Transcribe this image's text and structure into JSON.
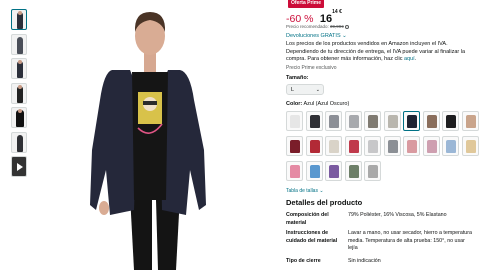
{
  "badge": "Oferta Prime",
  "price": {
    "discount": "-60 %",
    "whole": "16",
    "fraction": "14 €"
  },
  "reference": {
    "label": "Precio recomendado:",
    "value": "39,99€"
  },
  "returns_link": "Devoluciones GRATIS",
  "vat": {
    "text": "Los precios de los productos vendidos en Amazon incluyen el IVA. Dependiendo de tu dirección de entrega, el IVA puede variar al finalizar la compra. Para obtener más información, haz clic",
    "link": "aquí"
  },
  "prime_note": "Precio Prime exclusivo",
  "size": {
    "label": "Tamaño:",
    "value": "L"
  },
  "color": {
    "label": "Color:",
    "value": "Azul (Azul Oscuro)"
  },
  "swatch_colors": [
    [
      "#e6e6e6",
      "#2f3035",
      "#8c8f96",
      "#a7a9ad",
      "#7f7a71",
      "#b9b6ae",
      "#1f2433",
      "#8a6e5c",
      "#1d1d1f",
      "#c9a48b"
    ],
    [
      "#7a1d2a",
      "#b22a36",
      "#d9d3c8",
      "#c03a4c",
      "#c7c7c9",
      "#8b8f95",
      "#d99aa0",
      "#ce9fb0",
      "#9bb7d6",
      "#e0c89a"
    ],
    [
      "#e58aa4",
      "#5a98cf",
      "#7a5aa0",
      "#6d7f68",
      "#a9a9a9"
    ]
  ],
  "selected_swatch": "0-6",
  "size_chart_link": "Tabla de tallas",
  "details": {
    "title": "Detalles del producto",
    "rows": [
      {
        "key": "Composición del material",
        "value": "79% Poliéster, 16% Viscosa, 5% Elastano"
      },
      {
        "key": "Instrucciones de cuidado del material",
        "value": "Lavar a mano, no usar secador, hierro a temperatura media. Temperatura de alta prueba: 150°, no usar lejía"
      },
      {
        "key": "Tipo de cierre",
        "value": "Sin indicación"
      }
    ]
  }
}
